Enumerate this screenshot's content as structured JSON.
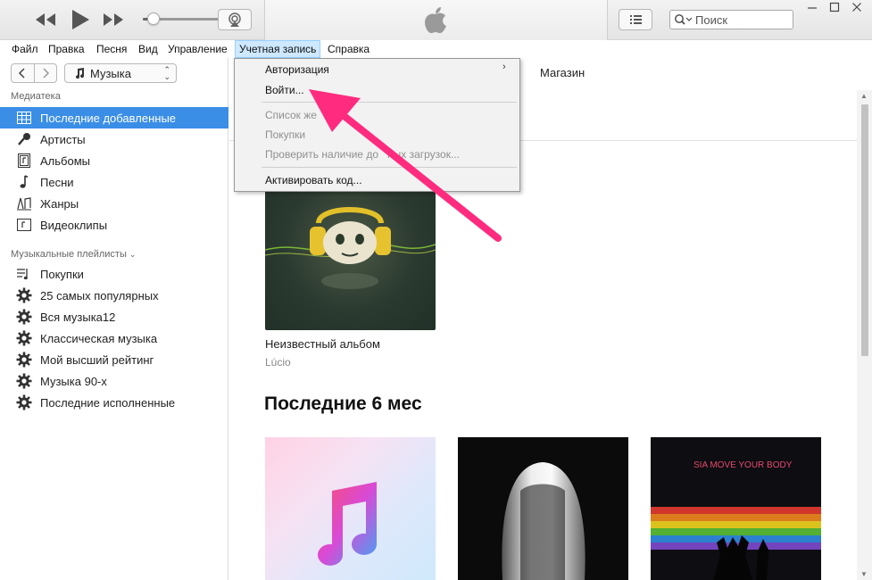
{
  "toolbar": {
    "search_placeholder": "Поиск",
    "volume_level": 0.13
  },
  "menubar": {
    "items": [
      "Файл",
      "Правка",
      "Песня",
      "Вид",
      "Управление",
      "Учетная запись",
      "Справка"
    ],
    "active": "Учетная запись"
  },
  "account_menu": {
    "items": [
      {
        "label": "Авторизация",
        "enabled": true,
        "submenu": true
      },
      {
        "label": "Войти...",
        "enabled": true
      },
      {
        "label": "Список же",
        "enabled": false
      },
      {
        "label": "Покупки",
        "enabled": false
      },
      {
        "label": "Проверить наличие до",
        "label_tail": "ных загрузок...",
        "enabled": false
      },
      {
        "label": "Активировать код...",
        "enabled": true
      }
    ]
  },
  "sidebar": {
    "media_select": "Музыка",
    "library_heading": "Медиатека",
    "library": [
      {
        "label": "Последние добавленные",
        "icon": "grid-icon",
        "selected": true
      },
      {
        "label": "Артисты",
        "icon": "microphone-icon"
      },
      {
        "label": "Альбомы",
        "icon": "album-icon"
      },
      {
        "label": "Песни",
        "icon": "note-icon"
      },
      {
        "label": "Жанры",
        "icon": "genres-icon"
      },
      {
        "label": "Видеоклипы",
        "icon": "video-icon"
      }
    ],
    "playlists_heading": "Музыкальные плейлисты",
    "playlists": [
      {
        "label": "Покупки",
        "icon": "playlist-icon"
      },
      {
        "label": "25 самых популярных",
        "icon": "gear-icon"
      },
      {
        "label": "Вся музыка12",
        "icon": "gear-icon"
      },
      {
        "label": "Классическая музыка",
        "icon": "gear-icon"
      },
      {
        "label": "Мой высший рейтинг",
        "icon": "gear-icon"
      },
      {
        "label": "Музыка 90-х",
        "icon": "gear-icon"
      },
      {
        "label": "Последние исполненные",
        "icon": "gear-icon"
      }
    ]
  },
  "main": {
    "store_tab": "Магазин",
    "album1": {
      "title": "Неизвестный альбом",
      "artist": "Lúcio"
    },
    "section_title": "Последние 6 мес",
    "album4_text": "SIA MOVE YOUR BODY"
  },
  "colors": {
    "selection": "#3a8ee6",
    "annotation_arrow": "#ff2b7e"
  }
}
